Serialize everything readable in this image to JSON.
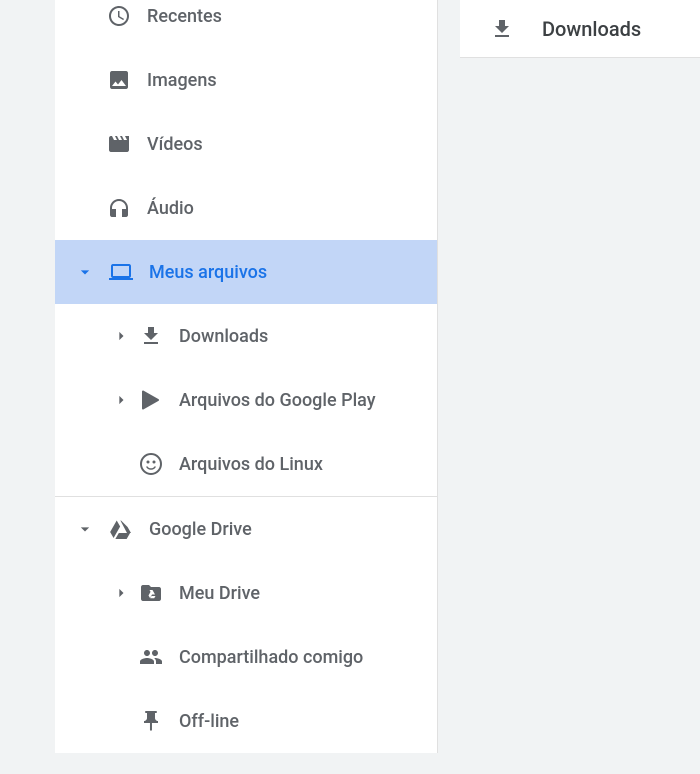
{
  "sidebar": {
    "recents": "Recentes",
    "images": "Imagens",
    "videos": "Vídeos",
    "audio": "Áudio",
    "myfiles": "Meus arquivos",
    "downloads": "Downloads",
    "playfiles": "Arquivos do Google Play",
    "linuxfiles": "Arquivos do Linux",
    "gdrive": "Google Drive",
    "mydrive": "Meu Drive",
    "shared": "Compartilhado comigo",
    "offline": "Off-line"
  },
  "header": {
    "title": "Downloads"
  }
}
